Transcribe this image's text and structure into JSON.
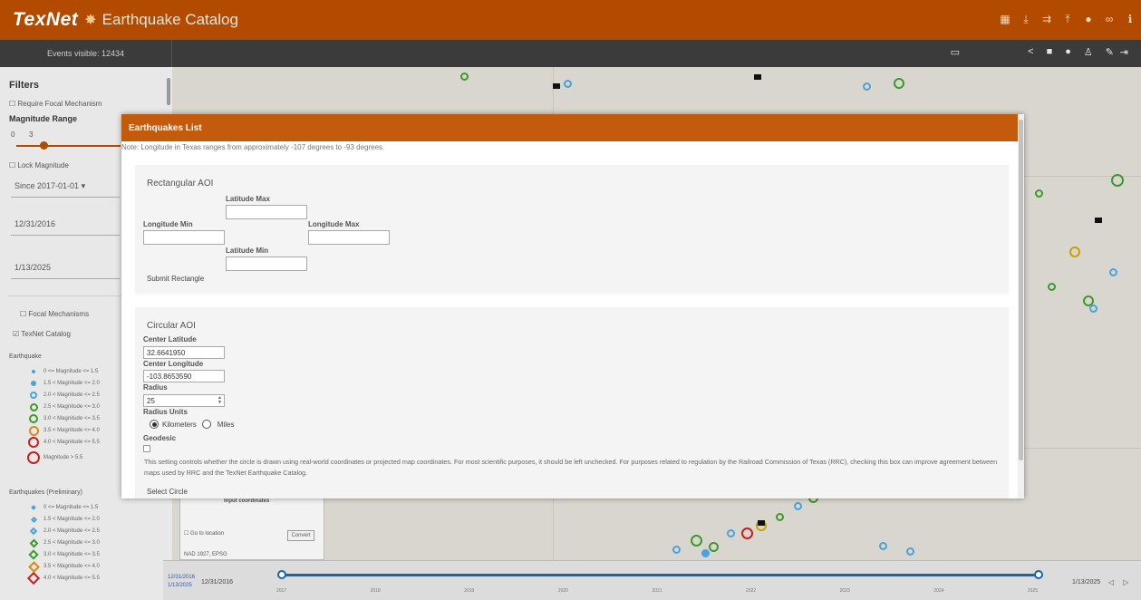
{
  "header": {
    "brand": "TexNet",
    "title": "Earthquake Catalog",
    "icons": [
      "layers-icon",
      "download-icon",
      "share-icon",
      "upload-icon",
      "location-icon",
      "link-icon",
      "info-icon"
    ]
  },
  "subbar": {
    "events_visible": "Events visible: 12434"
  },
  "sidebar": {
    "filters_title": "Filters",
    "require_focal": "Require Focal Mechanism",
    "magnitude_range": "Magnitude Range",
    "mag_min": "0",
    "mag_max": "3",
    "lock_magnitude": "Lock Magnitude",
    "since": "Since 2017-01-01",
    "start_date": "12/31/2016",
    "end_date": "1/13/2025",
    "focal_mechanisms": "Focal Mechanisms",
    "texnet_catalog": "TexNet Catalog",
    "earthquake_heading": "Earthquake",
    "legend": [
      "0 <= Magnitude <= 1.5",
      "1.5 < Magnitude <= 2.0",
      "2.0 < Magnitude <= 2.5",
      "2.5 < Magnitude <= 3.0",
      "3.0 < Magnitude <= 3.5",
      "3.5 < Magnitude <= 4.0",
      "4.0 < Magnitude <= 5.5",
      "Magnitude > 5.5"
    ],
    "prelim_heading": "Earthquakes (Preliminary)",
    "prelim_legend": [
      "0 <= Magnitude <= 1.5",
      "1.5 < Magnitude <= 2.0",
      "2.0 < Magnitude <= 2.5",
      "2.5 < Magnitude <= 3.0",
      "3.0 < Magnitude <= 3.5",
      "3.5 < Magnitude <= 4.0",
      "4.0 < Magnitude <= 5.5"
    ]
  },
  "info_panel": {
    "input_coordinates": "Input coordinates",
    "go_to_location": "Go to location",
    "convert": "Convert",
    "datum": "NAD 1927, EPSG"
  },
  "timeline": {
    "range_start": "12/31/2016",
    "range_end_small": "1/13/2025",
    "start_label": "12/31/2016",
    "end_label": "1/13/2025",
    "years": [
      "2017",
      "2018",
      "2019",
      "2020",
      "2021",
      "2022",
      "2023",
      "2024",
      "2025"
    ]
  },
  "modal": {
    "title": "Earthquakes List",
    "note": "Note: Longitude in Texas ranges from approximately -107 degrees to -93 degrees.",
    "rect": {
      "title": "Rectangular AOI",
      "lat_max_label": "Latitude Max",
      "lon_min_label": "Longitude Min",
      "lon_max_label": "Longitude Max",
      "lat_min_label": "Latitude Min",
      "lat_max": "",
      "lon_min": "",
      "lon_max": "",
      "lat_min": "",
      "submit": "Submit Rectangle"
    },
    "circle": {
      "title": "Circular AOI",
      "center_lat_label": "Center Latitude",
      "center_lat": "32.6641950",
      "center_lon_label": "Center Longitude",
      "center_lon": "-103.8653590",
      "radius_label": "Radius",
      "radius": "25",
      "units_label": "Radius Units",
      "unit_km": "Kilometers",
      "unit_mi": "Miles",
      "geodesic_label": "Geodesic",
      "geodesic_desc": "This setting controls whether the circle is drawn using real-world coordinates or projected map coordinates. For most scientific purposes, it should be left unchecked. For purposes related to regulation by the Railroad Commission of Texas (RRC), checking this box can improve agreement between maps used by RRC and the TexNet Earthquake Catalog.",
      "select": "Select Circle"
    }
  },
  "colors": {
    "header": "#b24a00",
    "modal_header": "#c45a0c",
    "timeline": "#1565a8"
  }
}
